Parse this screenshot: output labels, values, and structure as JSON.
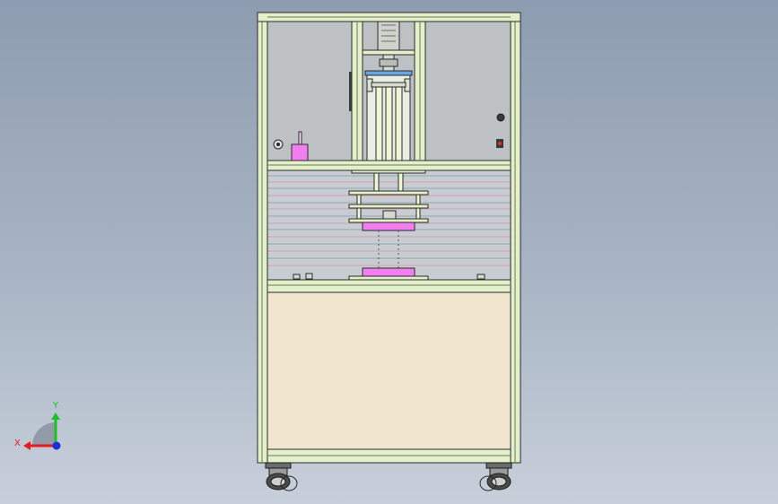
{
  "triad": {
    "x_label": "X",
    "y_label": "Y",
    "x_color": "#e01e1e",
    "y_color": "#1fbf2a",
    "z_color": "#1f2fd6"
  },
  "colors": {
    "frame_fill": "#e4f0cc",
    "frame_stroke": "#2a2a2a",
    "upper_panel": "#bfc2c5",
    "middle_panel": "#c9cfd4",
    "lower_panel": "#f0e6d0",
    "pink_part": "#f27ef0",
    "cylinder": "#f0f5d8",
    "blue_plate": "#6aa7e0"
  }
}
